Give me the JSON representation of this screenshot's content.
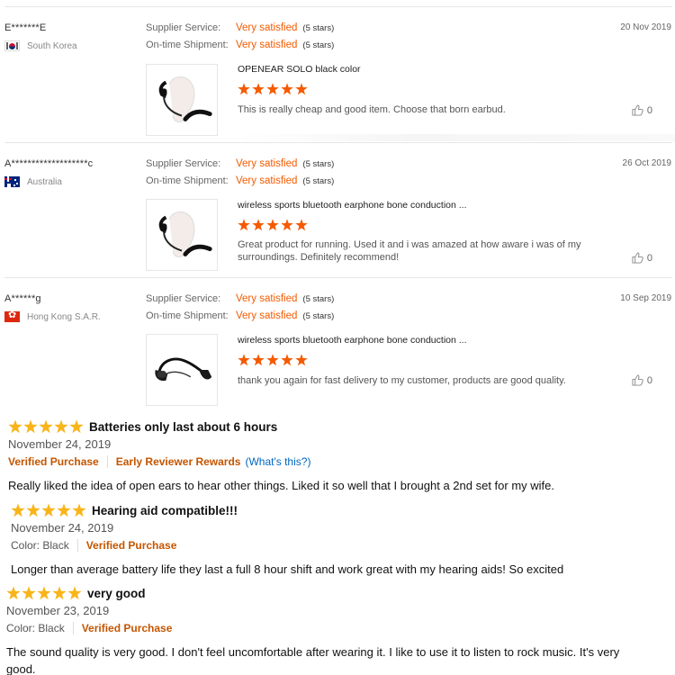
{
  "ali_reviews": [
    {
      "user": "E*******E",
      "country": "South Korea",
      "flag": "kr",
      "date": "20 Nov 2019",
      "supplier_label": "Supplier Service:",
      "supplier_value": "Very satisfied",
      "supplier_stars": "(5 stars)",
      "shipment_label": "On-time Shipment:",
      "shipment_value": "Very satisfied",
      "shipment_stars": "(5 stars)",
      "product_title": "OPENEAR SOLO black color",
      "rating": 5,
      "text": "This is really cheap and good item. Choose that born earbud.",
      "likes": "0"
    },
    {
      "user": "A*******************c",
      "country": "Australia",
      "flag": "au",
      "date": "26 Oct 2019",
      "supplier_label": "Supplier Service:",
      "supplier_value": "Very satisfied",
      "supplier_stars": "(5 stars)",
      "shipment_label": "On-time Shipment:",
      "shipment_value": "Very satisfied",
      "shipment_stars": "(5 stars)",
      "product_title": "wireless sports bluetooth earphone bone conduction ...",
      "rating": 5,
      "text": "Great product for running. Used it and i was amazed at how aware i was of my surroundings. Definitely recommend!",
      "likes": "0"
    },
    {
      "user": "A******g",
      "country": "Hong Kong S.A.R.",
      "flag": "hk",
      "date": "10 Sep 2019",
      "supplier_label": "Supplier Service:",
      "supplier_value": "Very satisfied",
      "supplier_stars": "(5 stars)",
      "shipment_label": "On-time Shipment:",
      "shipment_value": "Very satisfied",
      "shipment_stars": "(5 stars)",
      "product_title": "wireless sports bluetooth earphone bone conduction ...",
      "rating": 5,
      "text": "thank you again for fast delivery to my customer, products are good quality.",
      "likes": "0"
    }
  ],
  "amz_reviews": [
    {
      "rating": 5,
      "title": "Batteries only last about 6 hours",
      "date": "November 24, 2019",
      "verified": "Verified Purchase",
      "badge": "Early Reviewer Rewards",
      "badge_link": "(What's this?)",
      "body": "Really liked the idea of open ears to hear other things. Liked it so well that I brought a 2nd set for my wife."
    },
    {
      "rating": 5,
      "title": "Hearing aid compatible!!!",
      "date": "November 24, 2019",
      "color": "Color: Black",
      "verified": "Verified Purchase",
      "body": "Longer than average battery life they last a full 8 hour shift and work great with my hearing aids! So excited"
    },
    {
      "rating": 5,
      "title": "very good",
      "date": "November 23, 2019",
      "color": "Color: Black",
      "verified": "Verified Purchase",
      "body": "The sound quality is very good. I don't feel uncomfortable after wearing it. I like to use it to listen to rock music. It's very good."
    }
  ],
  "colors": {
    "ali_accent": "#f55a00",
    "amz_star": "#f8b51b",
    "amz_verified": "#c45500",
    "amz_link": "#0066c0"
  },
  "icons": [
    "thumbs-up-icon",
    "star-icon",
    "flag-icon"
  ]
}
